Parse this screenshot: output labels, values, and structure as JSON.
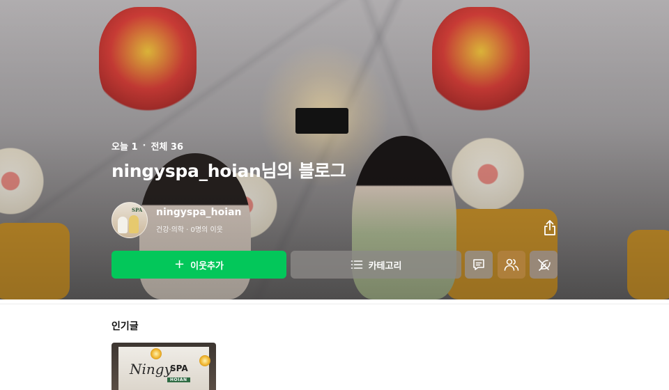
{
  "header": {
    "today_label": "오늘 1",
    "separator": "·",
    "total_label": "전체 36",
    "blog_title": "ningyspa_hoian님의 블로그"
  },
  "profile": {
    "name": "ningyspa_hoian",
    "meta": "건강·의학 · 0명의 이웃",
    "avatar_text": "SPA"
  },
  "actions": {
    "follow_label": "이웃추가",
    "category_label": "카테고리",
    "follow_color": "#03c75a"
  },
  "icons": {
    "share": "share-icon",
    "plus": "plus-icon",
    "list": "list-icon",
    "chat": "chat-icon",
    "neighbors": "people-icon",
    "mute": "feather-off-icon"
  },
  "popular": {
    "title": "인기글",
    "posts": [
      {
        "logo": "Ningy",
        "brand": "SPA",
        "sub": "HOIAN"
      }
    ]
  }
}
